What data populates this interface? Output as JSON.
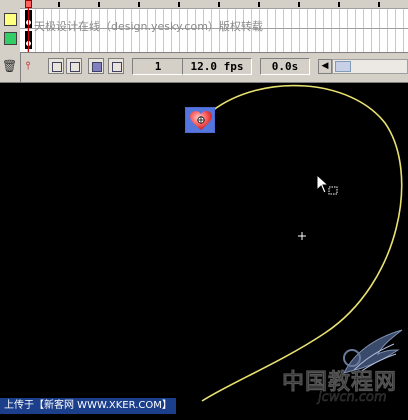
{
  "timeline": {
    "watermark": "天极设计在线（design.yesky.com）版权转载",
    "current_frame": "1",
    "frame_rate": "12.0 fps",
    "elapsed_time": "0.0s",
    "scroll_left_glyph": "◀",
    "center_frame_glyph": "⫯",
    "trash_glyph": "🗑"
  },
  "layers": [
    {
      "color": "#ffff80"
    },
    {
      "color": "#33cc66"
    }
  ],
  "stage": {
    "path_color": "#e8e070",
    "symbol_name": "heart-symbol"
  },
  "watermarks": {
    "logo_text": "中国教程网",
    "logo_url": "jcwcn.com",
    "upload_credit": "上传于【新客网 WWW.XKER.COM】"
  }
}
